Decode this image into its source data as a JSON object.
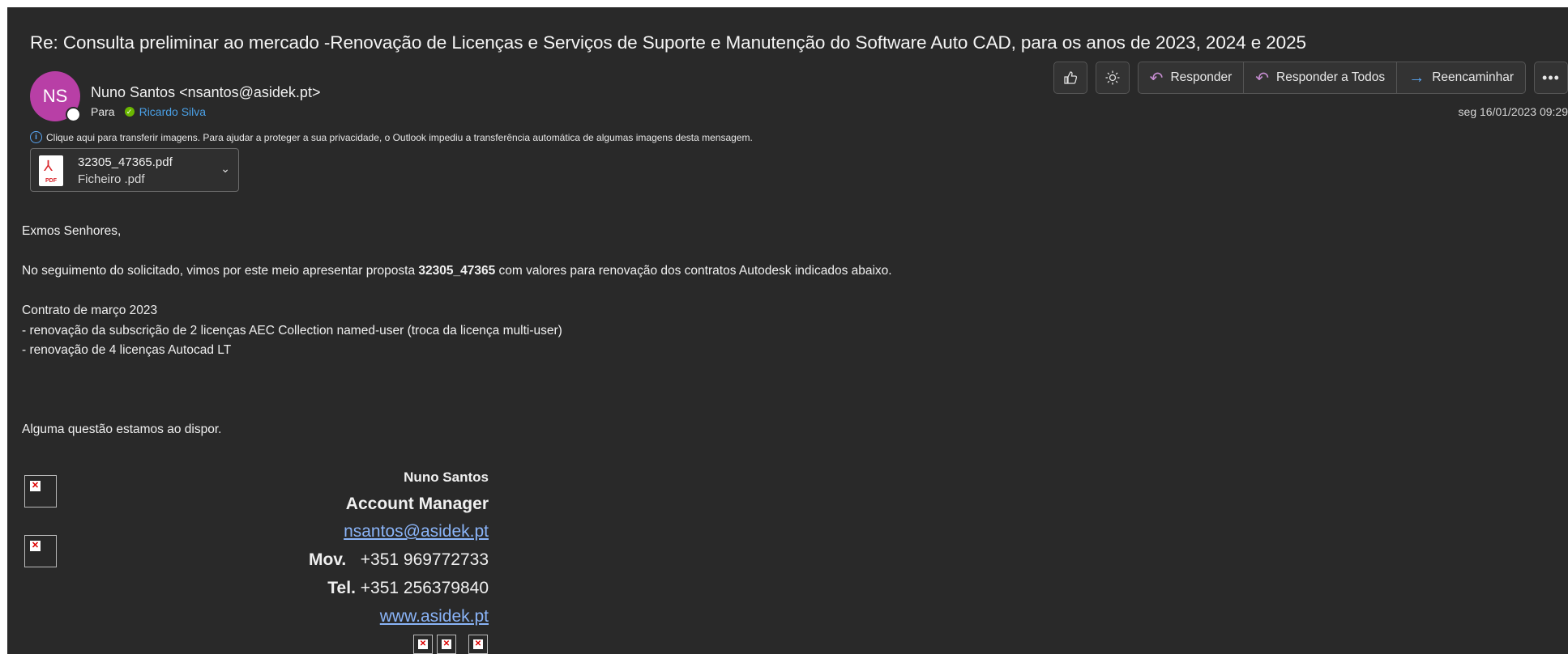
{
  "subject": "Re: Consulta preliminar ao mercado -Renovação de Licenças e Serviços de Suporte e Manutenção do Software Auto CAD, para os anos de 2023, 2024 e 2025",
  "sender": {
    "initials": "NS",
    "display": "Nuno Santos <nsantos@asidek.pt>",
    "to_label": "Para",
    "recipient": "Ricardo Silva"
  },
  "toolbar": {
    "reply": "Responder",
    "reply_all": "Responder a Todos",
    "forward": "Reencaminhar"
  },
  "date": "seg 16/01/2023 09:29",
  "info_bar": "Clique aqui para transferir imagens. Para ajudar a proteger a sua privacidade, o Outlook impediu a transferência automática de algumas imagens desta mensagem.",
  "attachment": {
    "name": "32305_47365.pdf",
    "type": "Ficheiro .pdf",
    "icon_label": "PDF"
  },
  "body": {
    "greeting": "Exmos Senhores,",
    "intro_before": "No seguimento do solicitado, vimos por este meio apresentar proposta ",
    "intro_bold": "32305_47365",
    "intro_after": " com valores para renovação dos contratos Autodesk indicados abaixo.",
    "contract_title": "Contrato de março 2023",
    "line1": "- renovação da subscrição de 2 licenças AEC Collection named-user (troca da licença multi-user)",
    "line2": "- renovação de 4 licenças Autocad LT",
    "closing": "Alguma questão estamos ao dispor."
  },
  "signature": {
    "name": "Nuno Santos",
    "role": "Account Manager",
    "email": "nsantos@asidek.pt",
    "mov_label": "Mov.",
    "mov": "+351 969772733",
    "tel_label": "Tel.",
    "tel": "+351 256379840",
    "web": "www.asidek.pt"
  }
}
